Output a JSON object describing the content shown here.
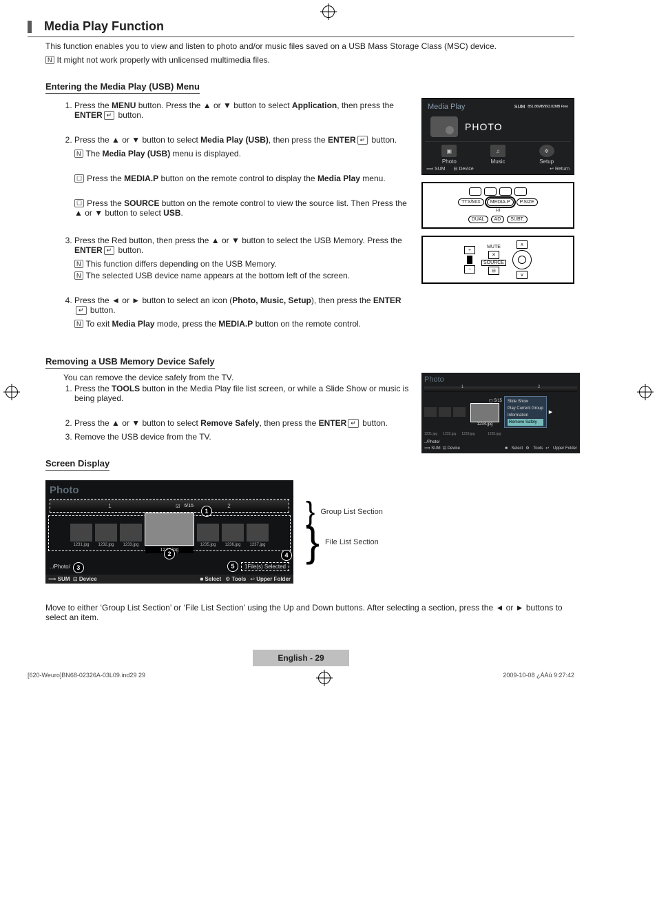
{
  "title": "Media Play Function",
  "intro": {
    "line1": "This function enables you to view and listen to photo and/or music files saved on a USB Mass Storage Class (MSC) device.",
    "note1": "It might not work properly with unlicensed multimedia files."
  },
  "entering": {
    "heading": "Entering the Media Play (USB) Menu",
    "step1_a": "Press the ",
    "step1_menu": "MENU",
    "step1_b": " button. Press the ▲ or ▼ button to select ",
    "step1_app": "Application",
    "step1_c": ", then press the ",
    "step1_enter": "ENTER",
    "step1_d": " button.",
    "step2_a": "Press the ▲ or ▼ button to select ",
    "step2_mp": "Media Play (USB)",
    "step2_b": ", then press the ",
    "step2_enter": "ENTER",
    "step2_c": " button.",
    "step2_note1_a": "The ",
    "step2_note1_b": "Media Play (USB)",
    "step2_note1_c": " menu is displayed.",
    "step2_r1_a": "Press the ",
    "step2_r1_b": "MEDIA.P",
    "step2_r1_c": " button on the remote control to display the ",
    "step2_r1_d": "Media Play",
    "step2_r1_e": " menu.",
    "step2_r2_a": "Press the ",
    "step2_r2_b": "SOURCE",
    "step2_r2_c": " button on the remote control to view the source list. Then Press the ▲ or ▼ button to select ",
    "step2_r2_d": "USB",
    "step2_r2_e": ".",
    "step3_a": "Press the Red button, then press the ▲ or ▼ button to select the USB Memory. Press the ",
    "step3_enter": "ENTER",
    "step3_b": " button.",
    "step3_note1": "This function differs depending on the USB Memory.",
    "step3_note2": "The selected USB device name appears at the bottom left of the screen.",
    "step4_a": "Press the ◄ or ► button to select an icon (",
    "step4_b": "Photo, Music, Setup",
    "step4_c": "), then press the ",
    "step4_enter": "ENTER",
    "step4_d": " button.",
    "step4_note_a": "To exit ",
    "step4_note_b": "Media Play",
    "step4_note_c": " mode, press the ",
    "step4_note_d": "MEDIA.P",
    "step4_note_e": " button on the remote control."
  },
  "tvpanel": {
    "title": "Media Play",
    "sum": "SUM",
    "free": "851.86MB/993.02MB Free",
    "photo": "PHOTO",
    "btn_photo": "Photo",
    "btn_music": "Music",
    "btn_setup": "Setup",
    "foot_sum": "SUM",
    "foot_device": "Device",
    "foot_return": "Return"
  },
  "remoteA": {
    "b1": "TTX/MIX",
    "b2": "MEDIA.P",
    "b3": "P.SIZE",
    "b4": "DUAL",
    "b5": "AD",
    "b6": "SUBT.",
    "iii": "I-II"
  },
  "remoteB": {
    "mute": "MUTE",
    "source": "SOURCE",
    "plus": "+",
    "minus": "−"
  },
  "removing": {
    "heading": "Removing a USB Memory Device Safely",
    "lead": "You can remove the device safely from the TV.",
    "s1_a": "Press the ",
    "s1_b": "TOOLS",
    "s1_c": " button in the Media Play file list screen, or while a Slide Show or music is being played.",
    "s2_a": "Press the ▲ or ▼ button to select ",
    "s2_b": "Remove Safely",
    "s2_c": ", then press the ",
    "s2_enter": "ENTER",
    "s2_d": " button.",
    "s3": "Remove the USB device from the TV."
  },
  "rspanel": {
    "title": "Photo",
    "mark1": "1",
    "mark2": "2",
    "count": "5/15",
    "m1": "Slide Show",
    "m2": "Play Current Group",
    "m3": "Information",
    "m4": "Remove Safely",
    "t1": "1231.jpg",
    "t2": "1232.jpg",
    "t3": "1233.jpg",
    "t4": "1234.jpg",
    "t5": "1235.jpg",
    "path": "../Photo/",
    "f_sum": "SUM",
    "f_device": "Device",
    "f_select": "Select",
    "f_tools": "Tools",
    "f_upper": "Upper Folder"
  },
  "screen": {
    "heading": "Screen Display",
    "group_label": "Group List Section",
    "file_label": "File List Section",
    "move_note": "Move to either ‘Group List Section’ or ‘File List Section’ using the Up and Down buttons. After selecting a section, press the ◄ or ► buttons to select an item."
  },
  "bigpanel": {
    "title": "Photo",
    "g1": "1",
    "g2": "2",
    "count": "5/15",
    "f1": "1231.jpg",
    "f2": "1232.jpg",
    "f3": "1233.jpg",
    "f4": "1234.jpg",
    "f5": "1235.jpg",
    "f6": "1236.jpg",
    "f7": "1237.jpg",
    "path": "../Photo/",
    "selcount": "1File(s) Selected",
    "ft_sum": "SUM",
    "ft_device": "Device",
    "ft_select": "Select",
    "ft_tools": "Tools",
    "ft_upper": "Upper Folder",
    "c1": "1",
    "c2": "2",
    "c3": "3",
    "c4": "4",
    "c5": "5"
  },
  "footer": {
    "pill": "English - 29",
    "docleft": "[620-Weuro]BN68-02326A-03L09.ind29   29",
    "docright": "2009-10-08   ¿ÀÀü 9:27:42"
  }
}
